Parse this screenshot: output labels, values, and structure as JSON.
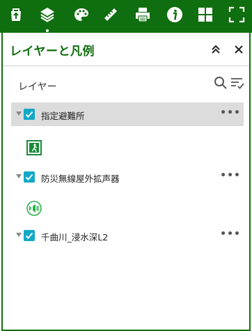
{
  "toolbar": {
    "tools": [
      {
        "name": "basemap-icon"
      },
      {
        "name": "layers-icon",
        "active": true
      },
      {
        "name": "palette-icon"
      },
      {
        "name": "measure-icon"
      },
      {
        "name": "print-icon"
      },
      {
        "name": "info-icon"
      },
      {
        "name": "grid-icon"
      },
      {
        "name": "fullscreen-icon"
      }
    ],
    "color": "#0f6e0f"
  },
  "panel": {
    "title": "レイヤーと凡例",
    "section_label": "レイヤー",
    "layers": [
      {
        "name": "指定避難所",
        "checked": true,
        "selected": true,
        "more": "•••",
        "legend_icon": "emergency-exit-icon"
      },
      {
        "name": "防災無線屋外拡声器",
        "checked": true,
        "selected": false,
        "more": "•••",
        "legend_icon": "loudspeaker-icon"
      },
      {
        "name": "千曲川_浸水深L2",
        "checked": true,
        "selected": false,
        "more": "•••"
      }
    ]
  },
  "colors": {
    "accent": "#0f6e0f",
    "checkbox": "#13a8c8",
    "selected_row": "#dcdcdc"
  }
}
